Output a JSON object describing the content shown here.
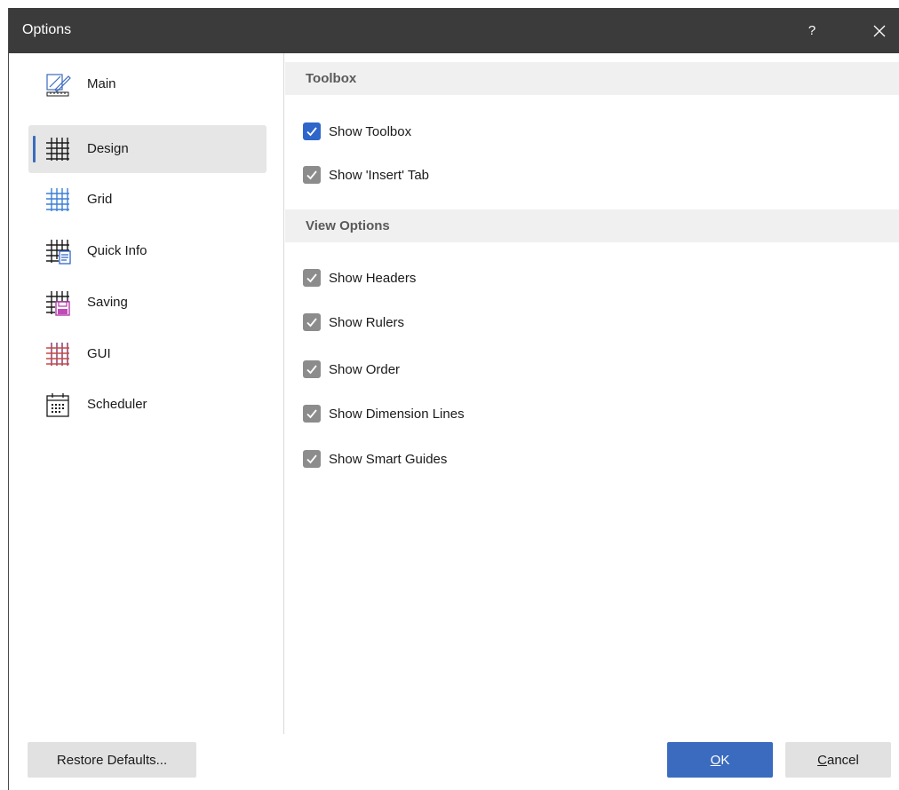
{
  "window": {
    "title": "Options",
    "help_label": "?"
  },
  "sidebar": {
    "items": [
      {
        "label": "Main",
        "icon": "ruler-pencil-icon",
        "selected": false
      },
      {
        "label": "Design",
        "icon": "grid-dark-icon",
        "selected": true
      },
      {
        "label": "Grid",
        "icon": "grid-blue-icon",
        "selected": false
      },
      {
        "label": "Quick Info",
        "icon": "grid-info-icon",
        "selected": false
      },
      {
        "label": "Saving",
        "icon": "grid-save-icon",
        "selected": false
      },
      {
        "label": "GUI",
        "icon": "grid-red-icon",
        "selected": false
      },
      {
        "label": "Scheduler",
        "icon": "calendar-icon",
        "selected": false
      }
    ]
  },
  "sections": {
    "toolbox": {
      "title": "Toolbox",
      "options": [
        {
          "label": "Show Toolbox",
          "checked": true,
          "style": "active"
        },
        {
          "label": "Show 'Insert' Tab",
          "checked": true,
          "style": "inactive"
        }
      ]
    },
    "view_options": {
      "title": "View Options",
      "options": [
        {
          "label": "Show Headers",
          "checked": true,
          "style": "inactive"
        },
        {
          "label": "Show Rulers",
          "checked": true,
          "style": "inactive"
        },
        {
          "label": "Show Order",
          "checked": true,
          "style": "inactive"
        },
        {
          "label": "Show Dimension Lines",
          "checked": true,
          "style": "inactive"
        },
        {
          "label": "Show Smart Guides",
          "checked": true,
          "style": "inactive"
        }
      ]
    }
  },
  "footer": {
    "restore_label": "Restore Defaults...",
    "ok_mnemonic": "O",
    "ok_rest": "K",
    "cancel_mnemonic": "C",
    "cancel_rest": "ancel"
  },
  "colors": {
    "titlebar": "#3b3b3b",
    "accent": "#3a6bbf",
    "checkbox_active": "#2f66c9",
    "checkbox_inactive": "#8c8c8c",
    "selected_item": "#e6e6e6",
    "section_header": "#f0f0f0"
  }
}
